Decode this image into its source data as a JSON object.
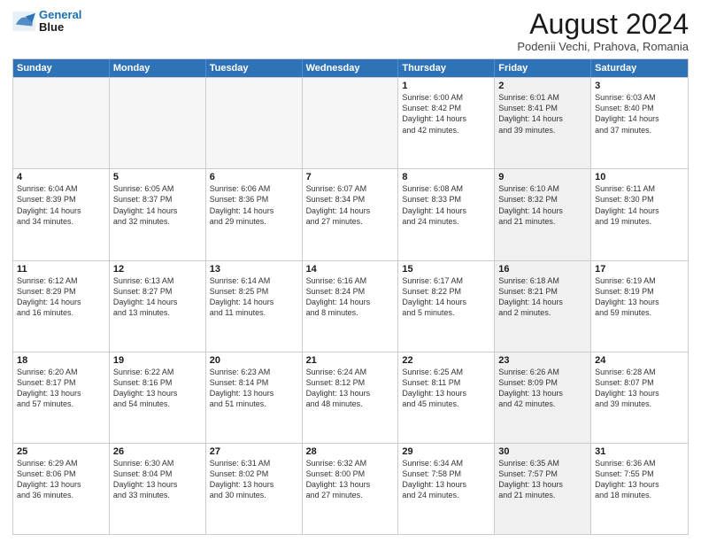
{
  "header": {
    "logo_line1": "General",
    "logo_line2": "Blue",
    "main_title": "August 2024",
    "subtitle": "Podenii Vechi, Prahova, Romania"
  },
  "calendar": {
    "weekdays": [
      "Sunday",
      "Monday",
      "Tuesday",
      "Wednesday",
      "Thursday",
      "Friday",
      "Saturday"
    ],
    "rows": [
      [
        {
          "day": "",
          "info": "",
          "empty": true
        },
        {
          "day": "",
          "info": "",
          "empty": true
        },
        {
          "day": "",
          "info": "",
          "empty": true
        },
        {
          "day": "",
          "info": "",
          "empty": true
        },
        {
          "day": "1",
          "info": "Sunrise: 6:00 AM\nSunset: 8:42 PM\nDaylight: 14 hours\nand 42 minutes."
        },
        {
          "day": "2",
          "info": "Sunrise: 6:01 AM\nSunset: 8:41 PM\nDaylight: 14 hours\nand 39 minutes."
        },
        {
          "day": "3",
          "info": "Sunrise: 6:03 AM\nSunset: 8:40 PM\nDaylight: 14 hours\nand 37 minutes."
        }
      ],
      [
        {
          "day": "4",
          "info": "Sunrise: 6:04 AM\nSunset: 8:39 PM\nDaylight: 14 hours\nand 34 minutes."
        },
        {
          "day": "5",
          "info": "Sunrise: 6:05 AM\nSunset: 8:37 PM\nDaylight: 14 hours\nand 32 minutes."
        },
        {
          "day": "6",
          "info": "Sunrise: 6:06 AM\nSunset: 8:36 PM\nDaylight: 14 hours\nand 29 minutes."
        },
        {
          "day": "7",
          "info": "Sunrise: 6:07 AM\nSunset: 8:34 PM\nDaylight: 14 hours\nand 27 minutes."
        },
        {
          "day": "8",
          "info": "Sunrise: 6:08 AM\nSunset: 8:33 PM\nDaylight: 14 hours\nand 24 minutes."
        },
        {
          "day": "9",
          "info": "Sunrise: 6:10 AM\nSunset: 8:32 PM\nDaylight: 14 hours\nand 21 minutes."
        },
        {
          "day": "10",
          "info": "Sunrise: 6:11 AM\nSunset: 8:30 PM\nDaylight: 14 hours\nand 19 minutes."
        }
      ],
      [
        {
          "day": "11",
          "info": "Sunrise: 6:12 AM\nSunset: 8:29 PM\nDaylight: 14 hours\nand 16 minutes."
        },
        {
          "day": "12",
          "info": "Sunrise: 6:13 AM\nSunset: 8:27 PM\nDaylight: 14 hours\nand 13 minutes."
        },
        {
          "day": "13",
          "info": "Sunrise: 6:14 AM\nSunset: 8:25 PM\nDaylight: 14 hours\nand 11 minutes."
        },
        {
          "day": "14",
          "info": "Sunrise: 6:16 AM\nSunset: 8:24 PM\nDaylight: 14 hours\nand 8 minutes."
        },
        {
          "day": "15",
          "info": "Sunrise: 6:17 AM\nSunset: 8:22 PM\nDaylight: 14 hours\nand 5 minutes."
        },
        {
          "day": "16",
          "info": "Sunrise: 6:18 AM\nSunset: 8:21 PM\nDaylight: 14 hours\nand 2 minutes."
        },
        {
          "day": "17",
          "info": "Sunrise: 6:19 AM\nSunset: 8:19 PM\nDaylight: 13 hours\nand 59 minutes."
        }
      ],
      [
        {
          "day": "18",
          "info": "Sunrise: 6:20 AM\nSunset: 8:17 PM\nDaylight: 13 hours\nand 57 minutes."
        },
        {
          "day": "19",
          "info": "Sunrise: 6:22 AM\nSunset: 8:16 PM\nDaylight: 13 hours\nand 54 minutes."
        },
        {
          "day": "20",
          "info": "Sunrise: 6:23 AM\nSunset: 8:14 PM\nDaylight: 13 hours\nand 51 minutes."
        },
        {
          "day": "21",
          "info": "Sunrise: 6:24 AM\nSunset: 8:12 PM\nDaylight: 13 hours\nand 48 minutes."
        },
        {
          "day": "22",
          "info": "Sunrise: 6:25 AM\nSunset: 8:11 PM\nDaylight: 13 hours\nand 45 minutes."
        },
        {
          "day": "23",
          "info": "Sunrise: 6:26 AM\nSunset: 8:09 PM\nDaylight: 13 hours\nand 42 minutes."
        },
        {
          "day": "24",
          "info": "Sunrise: 6:28 AM\nSunset: 8:07 PM\nDaylight: 13 hours\nand 39 minutes."
        }
      ],
      [
        {
          "day": "25",
          "info": "Sunrise: 6:29 AM\nSunset: 8:06 PM\nDaylight: 13 hours\nand 36 minutes."
        },
        {
          "day": "26",
          "info": "Sunrise: 6:30 AM\nSunset: 8:04 PM\nDaylight: 13 hours\nand 33 minutes."
        },
        {
          "day": "27",
          "info": "Sunrise: 6:31 AM\nSunset: 8:02 PM\nDaylight: 13 hours\nand 30 minutes."
        },
        {
          "day": "28",
          "info": "Sunrise: 6:32 AM\nSunset: 8:00 PM\nDaylight: 13 hours\nand 27 minutes."
        },
        {
          "day": "29",
          "info": "Sunrise: 6:34 AM\nSunset: 7:58 PM\nDaylight: 13 hours\nand 24 minutes."
        },
        {
          "day": "30",
          "info": "Sunrise: 6:35 AM\nSunset: 7:57 PM\nDaylight: 13 hours\nand 21 minutes."
        },
        {
          "day": "31",
          "info": "Sunrise: 6:36 AM\nSunset: 7:55 PM\nDaylight: 13 hours\nand 18 minutes."
        }
      ]
    ]
  }
}
